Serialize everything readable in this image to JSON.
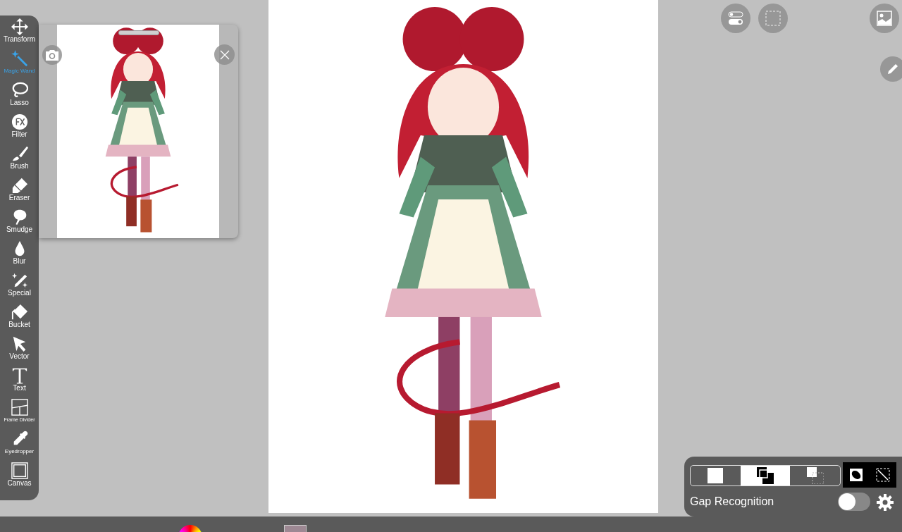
{
  "tools": [
    {
      "label": "Transform",
      "selected": false
    },
    {
      "label": "Magic Wand",
      "selected": true
    },
    {
      "label": "Lasso",
      "selected": false
    },
    {
      "label": "Filter",
      "selected": false
    },
    {
      "label": "Brush",
      "selected": false
    },
    {
      "label": "Eraser",
      "selected": false
    },
    {
      "label": "Smudge",
      "selected": false
    },
    {
      "label": "Blur",
      "selected": false
    },
    {
      "label": "Special",
      "selected": false
    },
    {
      "label": "Bucket",
      "selected": false
    },
    {
      "label": "Vector",
      "selected": false
    },
    {
      "label": "Text",
      "selected": false
    },
    {
      "label": "Frame Divider",
      "selected": false
    },
    {
      "label": "Eyedropper",
      "selected": false
    },
    {
      "label": "Canvas",
      "selected": false
    }
  ],
  "selection_panel": {
    "modes": [
      {
        "kind": "new",
        "selected": false
      },
      {
        "kind": "add",
        "selected": true
      },
      {
        "kind": "subtract",
        "selected": false
      }
    ],
    "gap_recognition": {
      "label": "Gap Recognition",
      "on": false
    }
  }
}
